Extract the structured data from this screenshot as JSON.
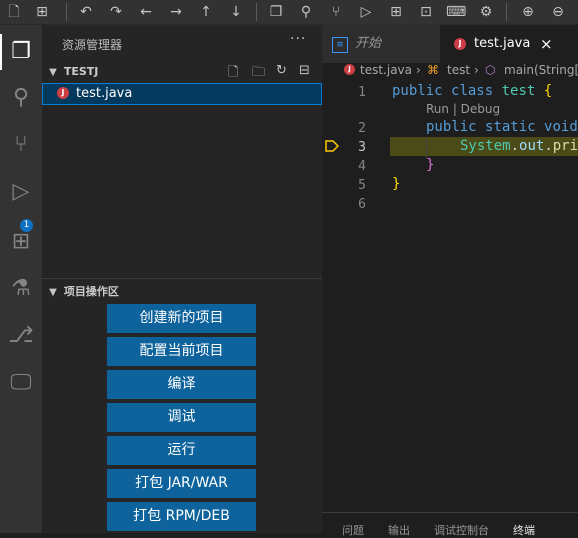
{
  "toolbar": {
    "icons": [
      "new-file",
      "save-all",
      "undo",
      "redo",
      "back",
      "forward",
      "up",
      "down",
      "copy",
      "search",
      "source-control",
      "run",
      "extensions",
      "terminal",
      "keyboard",
      "settings",
      "zoom-in",
      "zoom-out"
    ]
  },
  "activity": {
    "items": [
      "explorer",
      "search",
      "source-control",
      "run-debug",
      "extensions",
      "testing",
      "git-graph",
      "remote-explorer"
    ],
    "run_badge": "1"
  },
  "sidebar": {
    "title": "资源管理器",
    "more": "···",
    "folder": "TESTJ",
    "file": "test.java",
    "file_icon_letter": "J",
    "project_section": "项目操作区",
    "buttons": [
      "创建新的项目",
      "配置当前项目",
      "编译",
      "调试",
      "运行",
      "打包 JAR/WAR",
      "打包 RPM/DEB"
    ]
  },
  "editor": {
    "tabs": [
      {
        "label": "开始",
        "active": false
      },
      {
        "label": "test.java",
        "active": true,
        "close": "×"
      }
    ],
    "breadcrumb": [
      "test.java",
      "test",
      "main(String[]"
    ],
    "codelens": "Run | Debug",
    "line_numbers": [
      "1",
      "2",
      "3",
      "4",
      "5",
      "6"
    ],
    "code": {
      "l1_kw1": "public",
      "l1_kw2": "class",
      "l1_cls": "test",
      "l1_brace": "{",
      "l2_kw1": "public",
      "l2_kw2": "static",
      "l2_kw3": "void",
      "l3_cls": "System",
      "l3_dot1": ".",
      "l3_fld": "out",
      "l3_dot2": ".",
      "l3_fn": "pri",
      "l4_brace": "}",
      "l5_brace": "}"
    },
    "current_line": "3"
  },
  "panel": {
    "tabs": [
      {
        "label": "问题",
        "active": false
      },
      {
        "label": "输出",
        "active": false
      },
      {
        "label": "调试控制台",
        "active": false
      },
      {
        "label": "终端",
        "active": true
      }
    ]
  },
  "colors": {
    "accent": "#0e639c",
    "selection": "#04395e",
    "badge": "#0e70c0"
  }
}
